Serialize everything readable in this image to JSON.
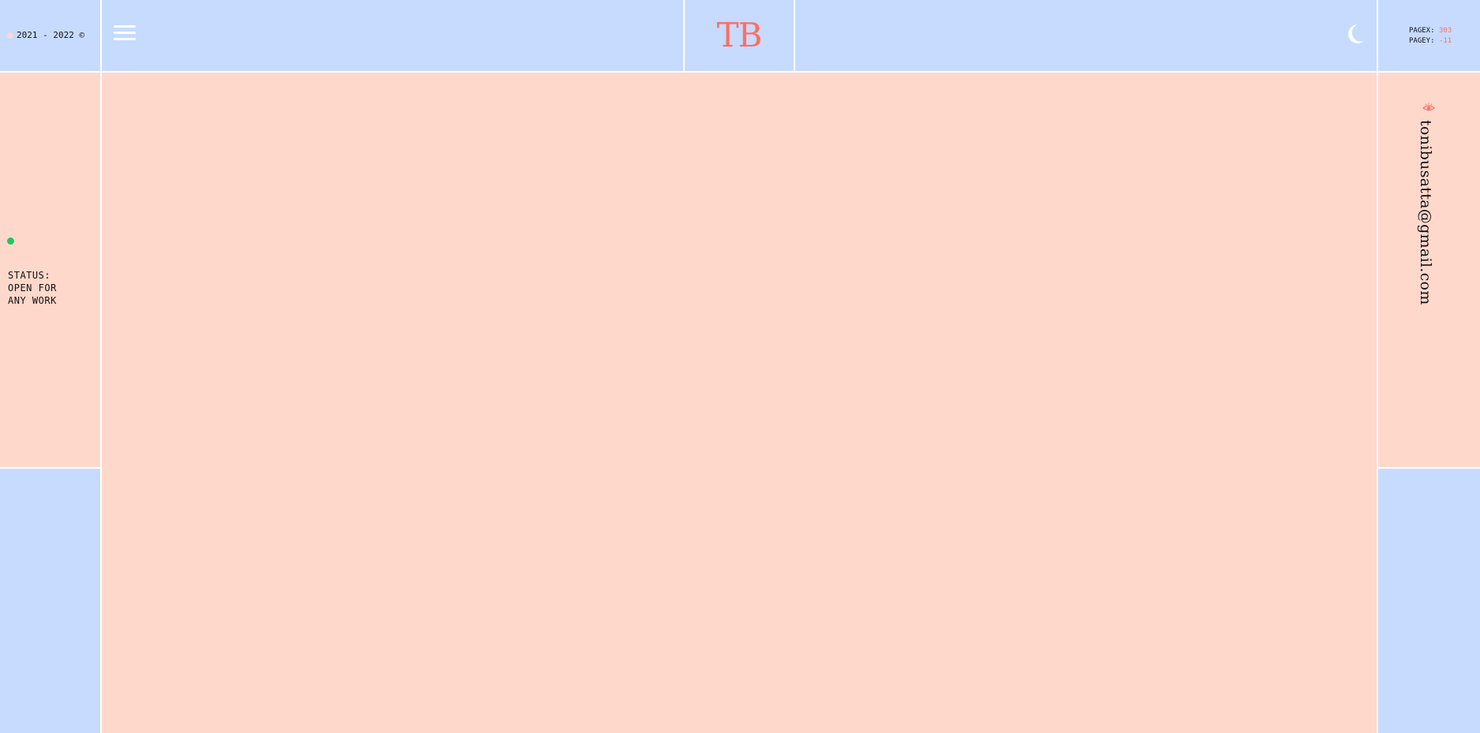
{
  "header": {
    "copyright": "2021 - 2022 ©",
    "logo": "TB",
    "coords": {
      "pagex_label": "PAGEX:",
      "pagex_value": "303",
      "pagey_label": "PAGEY:",
      "pagey_value": "-11"
    },
    "icons": {
      "menu": "hamburger-menu-icon",
      "theme": "moon-icon"
    }
  },
  "status": {
    "line1": "STATUS:",
    "line2": "OPEN FOR",
    "line3": "ANY WORK",
    "color": "#22c55e"
  },
  "contact": {
    "email": "tonibusatta@gmail.com",
    "icon": "eye-icon"
  },
  "colors": {
    "blue_panel": "#c6dbff",
    "peach_panel": "#ffd8cc",
    "accent": "#ff6e60",
    "divider": "#ffffff"
  }
}
